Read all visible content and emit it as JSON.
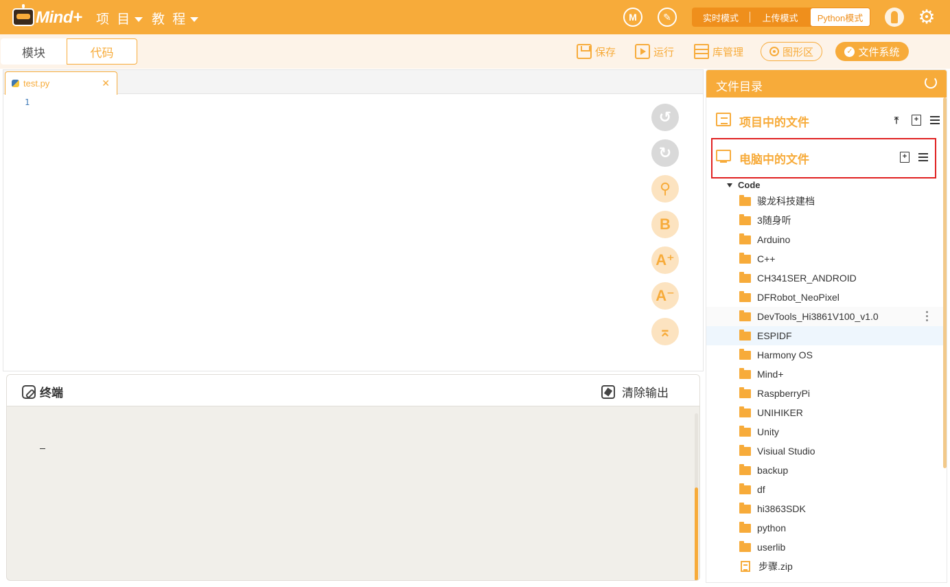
{
  "header": {
    "logo_text": "Mind+",
    "menus": [
      "项 目",
      "教 程"
    ],
    "modes": [
      "实时模式",
      "上传模式",
      "Python模式"
    ],
    "active_mode": "Python模式",
    "brand_color": "#f7ab3a"
  },
  "toolbar": {
    "tab_blocks": "模块",
    "tab_code": "代码",
    "save": "保存",
    "run": "运行",
    "library": "库管理",
    "graph": "图形区",
    "filesystem": "文件系统"
  },
  "editor": {
    "tab_name": "test.py",
    "line_numbers": [
      "1"
    ],
    "side_buttons": [
      "undo-icon",
      "redo-icon",
      "search-icon",
      "format-icon",
      "font-increase-icon",
      "font-decrease-icon",
      "scroll-top-icon"
    ]
  },
  "terminal": {
    "title": "终端",
    "clear": "清除输出"
  },
  "files": {
    "title": "文件目录",
    "project_section": "项目中的文件",
    "computer_section": "电脑中的文件",
    "root": "Code",
    "items": [
      {
        "name": "骏龙科技建档",
        "type": "folder"
      },
      {
        "name": "3随身听",
        "type": "folder"
      },
      {
        "name": "Arduino",
        "type": "folder"
      },
      {
        "name": "C++",
        "type": "folder"
      },
      {
        "name": "CH341SER_ANDROID",
        "type": "folder"
      },
      {
        "name": "DFRobot_NeoPixel",
        "type": "folder"
      },
      {
        "name": "DevTools_Hi3861V100_v1.0",
        "type": "folder"
      },
      {
        "name": "ESPIDF",
        "type": "folder"
      },
      {
        "name": "Harmony OS",
        "type": "folder"
      },
      {
        "name": "Mind+",
        "type": "folder"
      },
      {
        "name": "RaspberryPi",
        "type": "folder"
      },
      {
        "name": "UNIHIKER",
        "type": "folder"
      },
      {
        "name": "Unity",
        "type": "folder"
      },
      {
        "name": "Visiual Studio",
        "type": "folder"
      },
      {
        "name": "backup",
        "type": "folder"
      },
      {
        "name": "df",
        "type": "folder"
      },
      {
        "name": "hi3863SDK",
        "type": "folder"
      },
      {
        "name": "python",
        "type": "folder"
      },
      {
        "name": "userlib",
        "type": "folder"
      },
      {
        "name": "步骤.zip",
        "type": "file"
      }
    ]
  }
}
